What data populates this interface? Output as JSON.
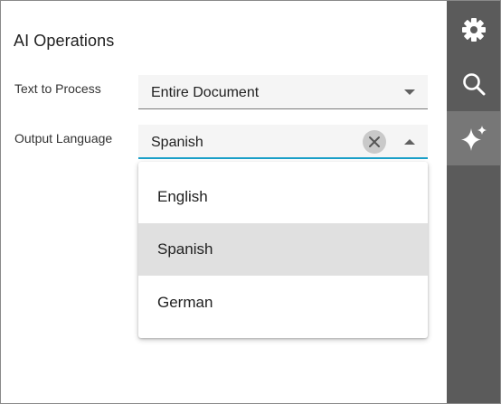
{
  "panel": {
    "title": "AI Operations"
  },
  "fields": {
    "text_to_process": {
      "label": "Text to Process",
      "value": "Entire Document"
    },
    "output_language": {
      "label": "Output Language",
      "value": "Spanish"
    }
  },
  "dropdown": {
    "options": [
      "English",
      "Spanish",
      "German"
    ],
    "selected": "Spanish"
  },
  "toolbar": {
    "buttons": [
      "gear-icon",
      "search-icon",
      "sparkle-icon"
    ],
    "active": "sparkle-icon"
  },
  "colors": {
    "accent": "#1ba0c8",
    "toolbar_bg": "#5b5b5b",
    "toolbar_active_bg": "#777777",
    "selected_option_bg": "#e0e0e0"
  }
}
